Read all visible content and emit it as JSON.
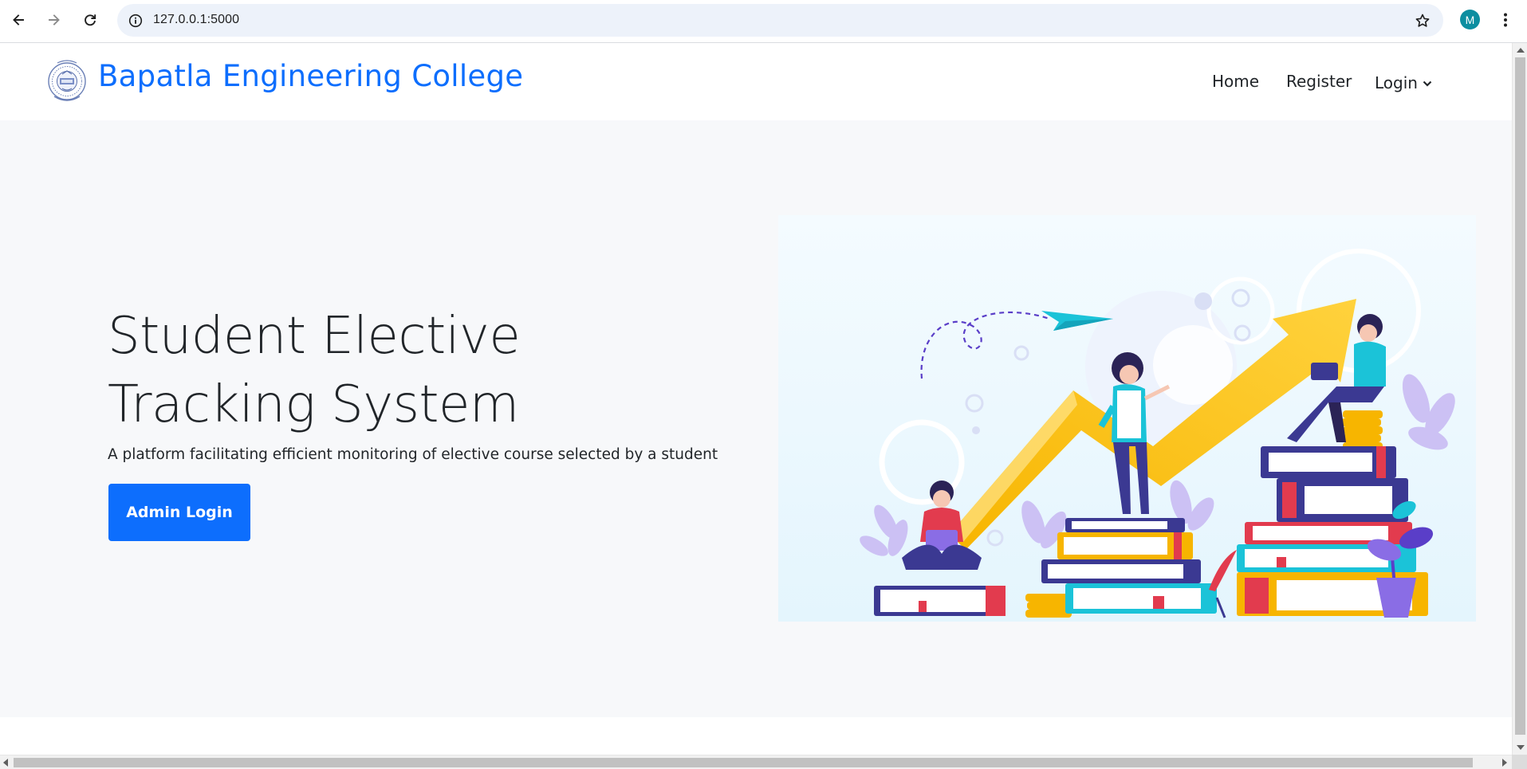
{
  "browser": {
    "url": "127.0.0.1:5000",
    "profile_initial": "M",
    "profile_color": "#0d8ea0",
    "icons": [
      "back-icon",
      "forward-icon",
      "reload-icon",
      "site-info-icon",
      "bookmark-star-icon",
      "more-vert-icon"
    ]
  },
  "navbar": {
    "brand": "Bapatla Engineering College",
    "brand_color": "#0d6efd",
    "items": {
      "home": "Home",
      "register": "Register",
      "login": "Login"
    }
  },
  "hero": {
    "title": "Student Elective Tracking System",
    "subtitle": "A platform facilitating efficient monitoring of elective course selected by a student",
    "button_label": "Admin Login",
    "button_color": "#0d6efd",
    "background": "#f7f8fa"
  }
}
